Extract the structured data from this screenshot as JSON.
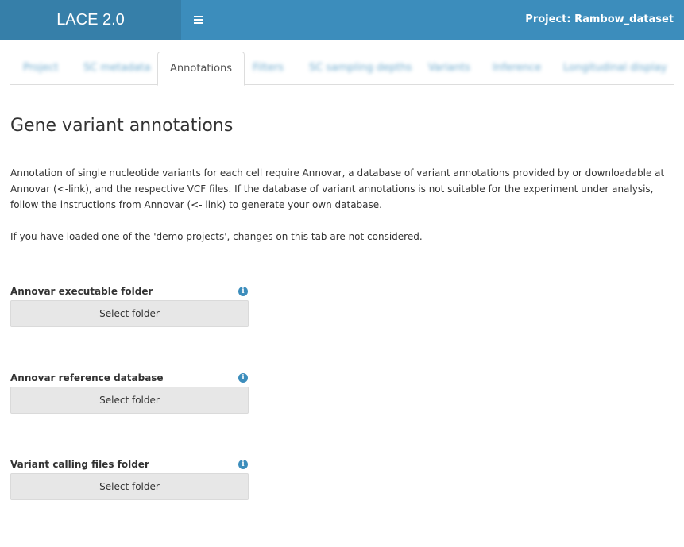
{
  "header": {
    "app_title": "LACE 2.0",
    "toggle_icon": "bars-icon",
    "project_label": "Project: Rambow_dataset",
    "colors": {
      "bar": "#3c8dbc",
      "logo_bg": "#367fa9"
    }
  },
  "tabs": [
    {
      "label": "Project",
      "active": false
    },
    {
      "label": "SC metadata",
      "active": false
    },
    {
      "label": "Annotations",
      "active": true
    },
    {
      "label": "Filters",
      "active": false
    },
    {
      "label": "SC sampling depths",
      "active": false
    },
    {
      "label": "Variants",
      "active": false
    },
    {
      "label": "Inference",
      "active": false
    },
    {
      "label": "Longitudinal display",
      "active": false
    }
  ],
  "main": {
    "title": "Gene variant annotations",
    "paragraph1": "Annotation of single nucleotide variants for each cell require Annovar, a database of variant annotations provided by or downloadable at Annovar (<-link), and the respective VCF files. If the database of variant annotations is not suitable for the experiment under analysis, follow the instructions from Annovar (<- link) to generate your own database.",
    "paragraph2": "If you have loaded one of the 'demo projects', changes on this tab are not considered.",
    "fields": [
      {
        "label": "Annovar executable folder",
        "button_label": "Select folder",
        "info_icon": "info-icon"
      },
      {
        "label": "Annovar reference database",
        "button_label": "Select folder",
        "info_icon": "info-icon"
      },
      {
        "label": "Variant calling files folder",
        "button_label": "Select folder",
        "info_icon": "info-icon"
      }
    ]
  }
}
